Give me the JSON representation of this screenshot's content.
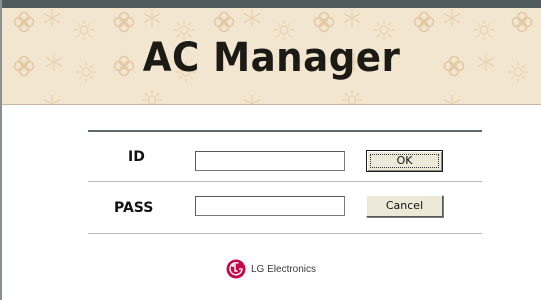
{
  "banner": {
    "title": "AC Manager",
    "background_color": "#f3e6d1",
    "pattern_color": "#e6cfae",
    "pattern_icons": [
      "flower-icon",
      "sun-icon",
      "snowflake-icon"
    ]
  },
  "login": {
    "id_label": "ID",
    "id_value": "",
    "pass_label": "PASS",
    "pass_value": "",
    "ok_label": "OK",
    "cancel_label": "Cancel"
  },
  "footer": {
    "brand_text": "LG Electronics",
    "logo_icon": "lg-logo-icon",
    "logo_color": "#c6094b"
  },
  "colors": {
    "top_rule": "#4e5a5e",
    "button_face": "#ece9d8"
  }
}
